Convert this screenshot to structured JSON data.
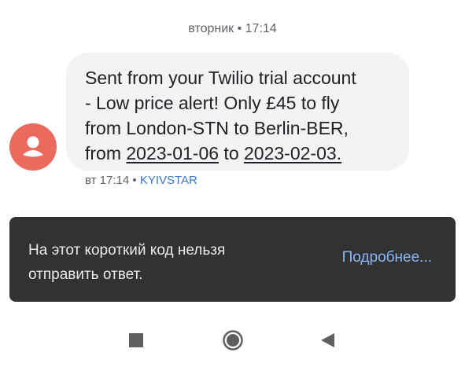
{
  "thread": {
    "date_header": "вторник • 17:14"
  },
  "message": {
    "line1": "Sent from your Twilio trial account",
    "line2": "- Low price alert! Only £45 to fly",
    "line3": "from London-STN to Berlin-BER,",
    "line4_from": "from ",
    "date_start": "2023-01-06",
    "line4_to": " to ",
    "date_end": "2023-02-03",
    "line4_end": "."
  },
  "meta": {
    "time": "вт 17:14",
    "separator": " • ",
    "carrier": "KYIVSTAR"
  },
  "snackbar": {
    "line1": "На этот короткий код нельзя",
    "line2": "отправить ответ.",
    "action": "Подробнее..."
  },
  "nav": {
    "recents": "recents-square-icon",
    "home": "home-circle-icon",
    "back": "back-triangle-icon"
  },
  "colors": {
    "avatar": "#ea6a5e",
    "bubble": "#f1f3f4",
    "snackbar": "#323232",
    "action": "#8ab4f8",
    "carrier": "#3c78c7"
  }
}
